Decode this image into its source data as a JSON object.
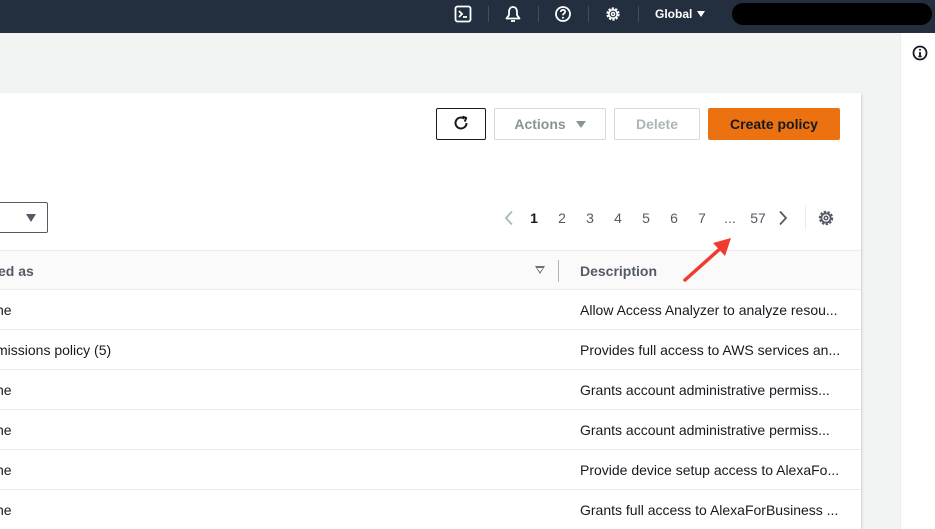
{
  "topbar": {
    "icons": [
      "cloudshell-icon",
      "notifications-icon",
      "help-icon",
      "settings-icon"
    ],
    "region_label": "Global"
  },
  "toolbar": {
    "refresh_icon": "refresh-icon",
    "actions_label": "Actions",
    "delete_label": "Delete",
    "create_label": "Create policy",
    "create_color": "#ec7211"
  },
  "pagination": {
    "pages": [
      "1",
      "2",
      "3",
      "4",
      "5",
      "6",
      "7",
      "...",
      "57"
    ],
    "current": "1"
  },
  "table": {
    "columns": [
      "ed as",
      "Description"
    ],
    "rows": [
      {
        "used_as": "ne",
        "description": "Allow Access Analyzer to analyze resou..."
      },
      {
        "used_as": "missions policy (5)",
        "description": "Provides full access to AWS services an..."
      },
      {
        "used_as": "ne",
        "description": "Grants account administrative permiss..."
      },
      {
        "used_as": "ne",
        "description": "Grants account administrative permiss..."
      },
      {
        "used_as": "ne",
        "description": "Provide device setup access to AlexaFo..."
      },
      {
        "used_as": "ne",
        "description": "Grants full access to AlexaForBusiness ..."
      }
    ]
  },
  "annotation": {
    "arrow_color": "#f03c2e"
  }
}
